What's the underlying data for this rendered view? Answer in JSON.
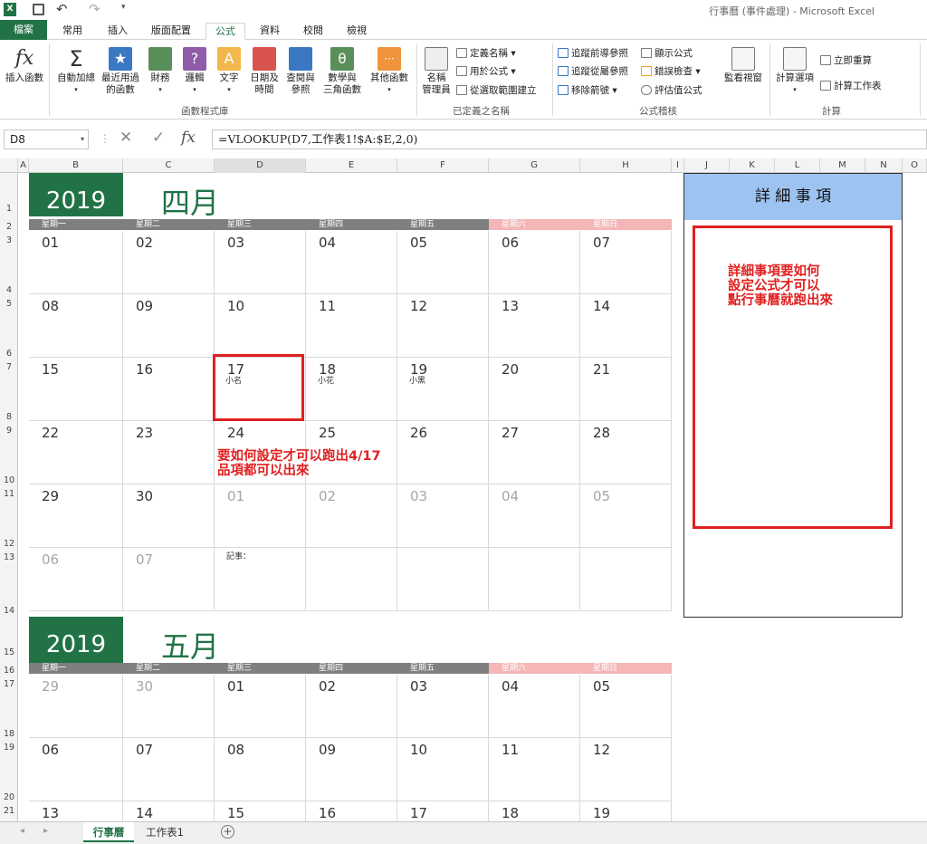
{
  "title_bar": {
    "text": "行事曆 (事件處理) - Microsoft Excel"
  },
  "ribbon_tabs": [
    "檔案",
    "常用",
    "插入",
    "版面配置",
    "公式",
    "資料",
    "校閱",
    "檢視"
  ],
  "ribbon": {
    "insert_function": "插入函數",
    "autosum": "自動加總",
    "recent": [
      "最近用過",
      "的函數"
    ],
    "finance": "財務",
    "logical": "邏輯",
    "text": "文字",
    "datetime": [
      "日期及",
      "時間"
    ],
    "lookup": [
      "查閱與",
      "參照"
    ],
    "math": [
      "數學與",
      "三角函數"
    ],
    "more": "其他函數",
    "library_label": "函數程式庫",
    "name_mgr": [
      "名稱",
      "管理員"
    ],
    "define_name": "定義名稱",
    "use_in_formula": "用於公式",
    "create_from_sel": "從選取範圍建立",
    "names_label": "已定義之名稱",
    "trace_prec": "追蹤前導參照",
    "trace_dep": "追蹤從屬參照",
    "remove_arrows": "移除箭號",
    "show_formulas": "顯示公式",
    "error_check": "錯誤檢查",
    "evaluate": "評估值公式",
    "audit_label": "公式稽核",
    "watch": "監看視窗",
    "calc_options": "計算選項",
    "calc_now": "立即重算",
    "calc_sheet": "計算工作表",
    "calc_label": "計算"
  },
  "name_box": "D8",
  "formula": "=VLOOKUP(D7,工作表1!$A:$E,2,0)",
  "columns": [
    "A",
    "B",
    "C",
    "D",
    "E",
    "F",
    "G",
    "H",
    "I",
    "J",
    "K",
    "L",
    "M",
    "N",
    "O"
  ],
  "rows": [
    "1",
    "2",
    "3",
    "4",
    "5",
    "6",
    "7",
    "8",
    "9",
    "10",
    "11",
    "12",
    "13",
    "14",
    "15",
    "16",
    "17",
    "18",
    "19",
    "20",
    "21"
  ],
  "april": {
    "year": "2019",
    "month": "四月",
    "weekdays": [
      "星期一",
      "星期二",
      "星期三",
      "星期四",
      "星期五",
      "星期六",
      "星期日"
    ],
    "weeks": [
      [
        "01",
        "02",
        "03",
        "04",
        "05",
        "06",
        "07"
      ],
      [
        "08",
        "09",
        "10",
        "11",
        "12",
        "13",
        "14"
      ],
      [
        "15",
        "16",
        "17",
        "18",
        "19",
        "20",
        "21"
      ],
      [
        "22",
        "23",
        "24",
        "25",
        "26",
        "27",
        "28"
      ],
      [
        "29",
        "30",
        "01",
        "02",
        "03",
        "04",
        "05"
      ],
      [
        "06",
        "07",
        "",
        "",
        "",
        "",
        ""
      ]
    ],
    "notes": {
      "n17": "小名",
      "n18": "小花",
      "n19": "小黑"
    },
    "memo_label": "記事："
  },
  "may": {
    "year": "2019",
    "month": "五月",
    "weekdays": [
      "星期一",
      "星期二",
      "星期三",
      "星期四",
      "星期五",
      "星期六",
      "星期日"
    ],
    "weeks": [
      [
        "29",
        "30",
        "01",
        "02",
        "03",
        "04",
        "05"
      ],
      [
        "06",
        "07",
        "08",
        "09",
        "10",
        "11",
        "12"
      ],
      [
        "13",
        "14",
        "15",
        "16",
        "17",
        "18",
        "19"
      ]
    ]
  },
  "detail": {
    "header": "詳 細 事 項"
  },
  "annotations": {
    "question1": [
      "要如何設定才可以跑出4/17",
      "品項都可以出來"
    ],
    "question2": [
      "詳細事項要如何",
      "設定公式才可以",
      "點行事曆就跑出來"
    ]
  },
  "sheets": [
    "行事曆",
    "工作表1"
  ],
  "colors": {
    "green": "#217346",
    "weekday_band": "#7f7f7f",
    "weekend_band": "#f4b6b6",
    "detail_header": "#9dc3f0",
    "annotation": "#e02020"
  }
}
